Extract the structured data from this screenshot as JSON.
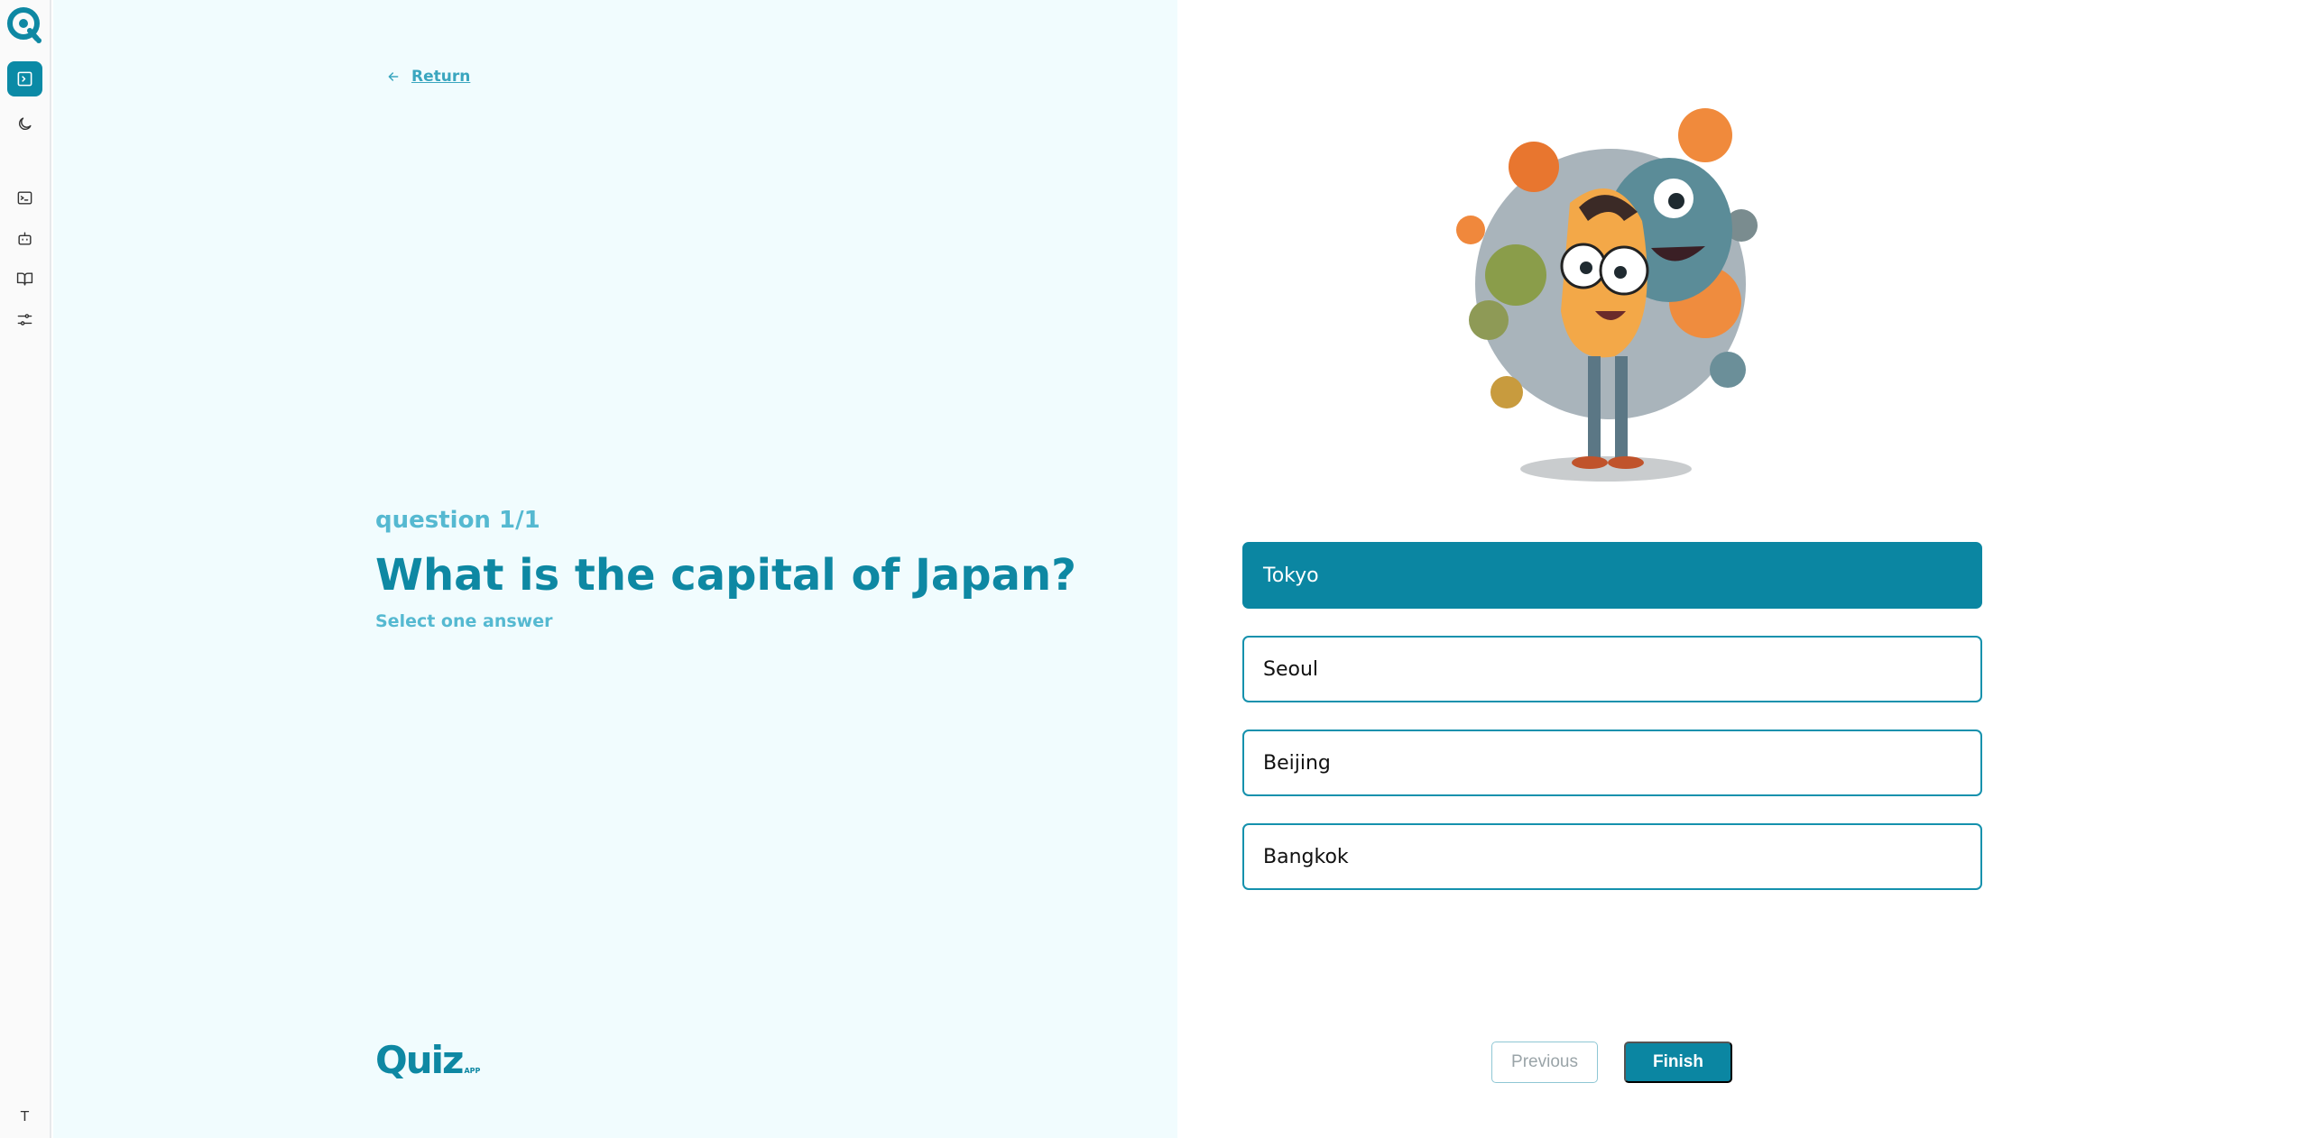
{
  "sidebar": {
    "items": [
      {
        "icon": "terminal-square-icon",
        "active": true
      },
      {
        "icon": "moon-icon",
        "active": false
      },
      {
        "icon": "terminal-icon",
        "active": false
      },
      {
        "icon": "bot-icon",
        "active": false
      },
      {
        "icon": "book-open-icon",
        "active": false
      },
      {
        "icon": "sliders-icon",
        "active": false
      }
    ],
    "user_initial": "T"
  },
  "quiz": {
    "return_label": "Return",
    "counter": "question 1/1",
    "question": "What is the capital of Japan?",
    "hint": "Select one answer",
    "answers": [
      {
        "label": "Tokyo",
        "selected": true
      },
      {
        "label": "Seoul",
        "selected": false
      },
      {
        "label": "Beijing",
        "selected": false
      },
      {
        "label": "Bangkok",
        "selected": false
      }
    ],
    "previous_label": "Previous",
    "finish_label": "Finish"
  },
  "brand": {
    "name": "Quiz",
    "suffix": "APP"
  },
  "colors": {
    "accent": "#0b86a2",
    "accent_light": "#55b9d1",
    "panel_bg": "#f1fcfe"
  }
}
